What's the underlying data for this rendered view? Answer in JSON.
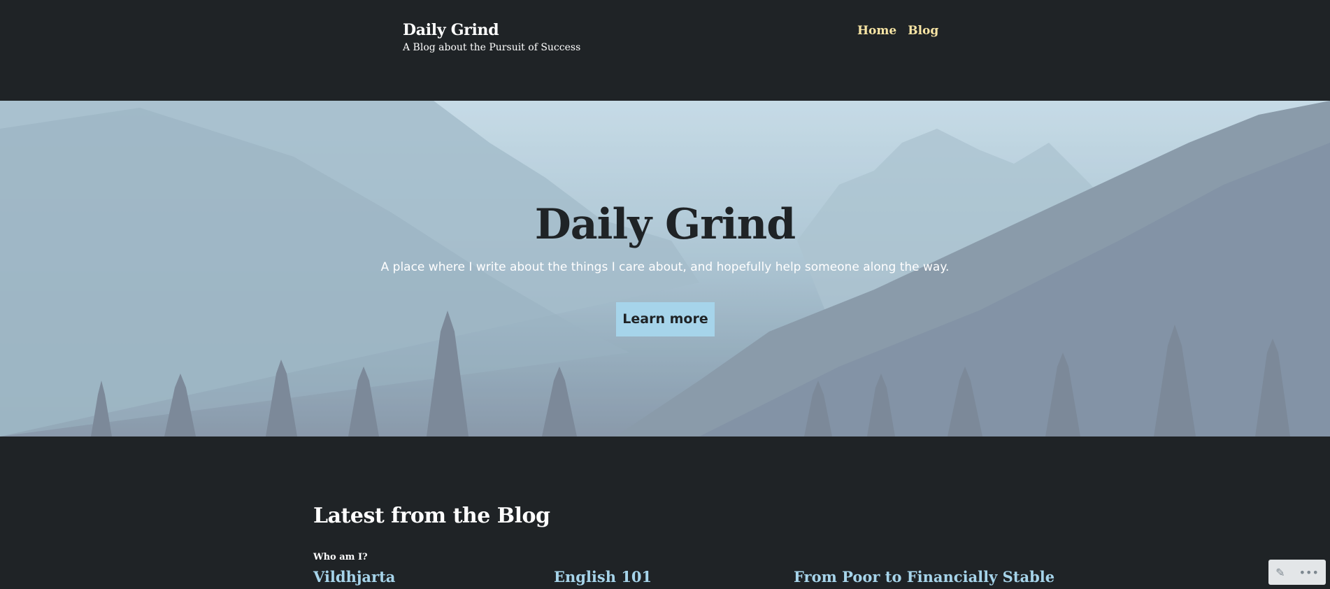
{
  "header": {
    "site_title": "Daily Grind",
    "tagline": "A Blog about the Pursuit of Success",
    "nav": [
      {
        "label": "Home"
      },
      {
        "label": "Blog"
      }
    ]
  },
  "hero": {
    "title": "Daily Grind",
    "subtitle": "A place where I write about the things I care about, and hopefully help someone along the way.",
    "button_label": "Learn more"
  },
  "latest": {
    "heading": "Latest from the Blog",
    "first_post_category": "Who am I?",
    "posts": [
      {
        "title": "Vildhjarta"
      },
      {
        "title": "English 101"
      },
      {
        "title": "From Poor to Financially Stable"
      }
    ]
  },
  "admin_toolbar": {
    "icons": [
      "pencil-icon",
      "more-icon"
    ],
    "edit_glyph": "✎",
    "more_glyph": "•••"
  },
  "colors": {
    "background": "#1f2326",
    "nav_link": "#f7e4a4",
    "accent": "#a6d4ea"
  }
}
